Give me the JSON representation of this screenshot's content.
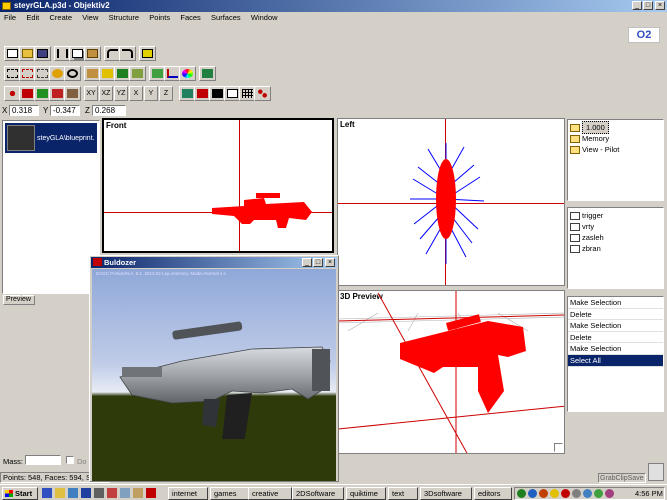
{
  "window": {
    "title": "steyrGLA.p3d - Objektiv2"
  },
  "menu": [
    "File",
    "Edit",
    "Create",
    "View",
    "Structure",
    "Points",
    "Faces",
    "Surfaces",
    "Window"
  ],
  "logo": {
    "text": "O2"
  },
  "axis_buttons": [
    "XY",
    "XZ",
    "YZ",
    "X",
    "Y",
    "Z"
  ],
  "coords": {
    "x_label": "X",
    "x_value": "0.318",
    "y_label": "Y",
    "y_value": "-0.347",
    "z_label": "Z",
    "z_value": "0.268"
  },
  "thumbnail": {
    "label": "steyGLA\\blueprint."
  },
  "preview_tab": "Preview",
  "viewports": {
    "front": "Front",
    "left": "Left",
    "preview3d": "3D Preview"
  },
  "lod_list": [
    {
      "label": "1.000",
      "selected": true
    },
    {
      "label": "Memory",
      "selected": false
    },
    {
      "label": "View - Pilot",
      "selected": false
    }
  ],
  "selection_list": [
    "trigger",
    "vrty",
    "zasleh",
    "zbran"
  ],
  "history": [
    {
      "label": "Make Selection",
      "selected": false
    },
    {
      "label": "Delete",
      "selected": false
    },
    {
      "label": "Make Selection",
      "selected": false
    },
    {
      "label": "Delete",
      "selected": false
    },
    {
      "label": "Make Selection",
      "selected": false
    },
    {
      "label": "Select All",
      "selected": true
    }
  ],
  "buldozer": {
    "title": "Buldozer",
    "info": "DAGC Portion/N.A. 8.1. 2013.02 Lay=memory, Mode=Normal s  s"
  },
  "mass": {
    "label": "Mass:",
    "check_label": "Do"
  },
  "status": {
    "text": "Points: 548, Faces: 594, Se"
  },
  "grab_button": "GrabClipSave",
  "taskbar": {
    "start": "Start",
    "groups": [
      "internet",
      "games",
      "creative",
      "2DSoftware",
      "quiktime",
      "text",
      "3Dsoftware",
      "editors"
    ],
    "clock": "4:56 PM"
  },
  "colors": {
    "accent": "#0a246a",
    "model": "#ff0000",
    "axis": "#cc0000",
    "normals": "#0000ff",
    "sky": "#7f9bd8",
    "ground": "#2e3a0a"
  }
}
